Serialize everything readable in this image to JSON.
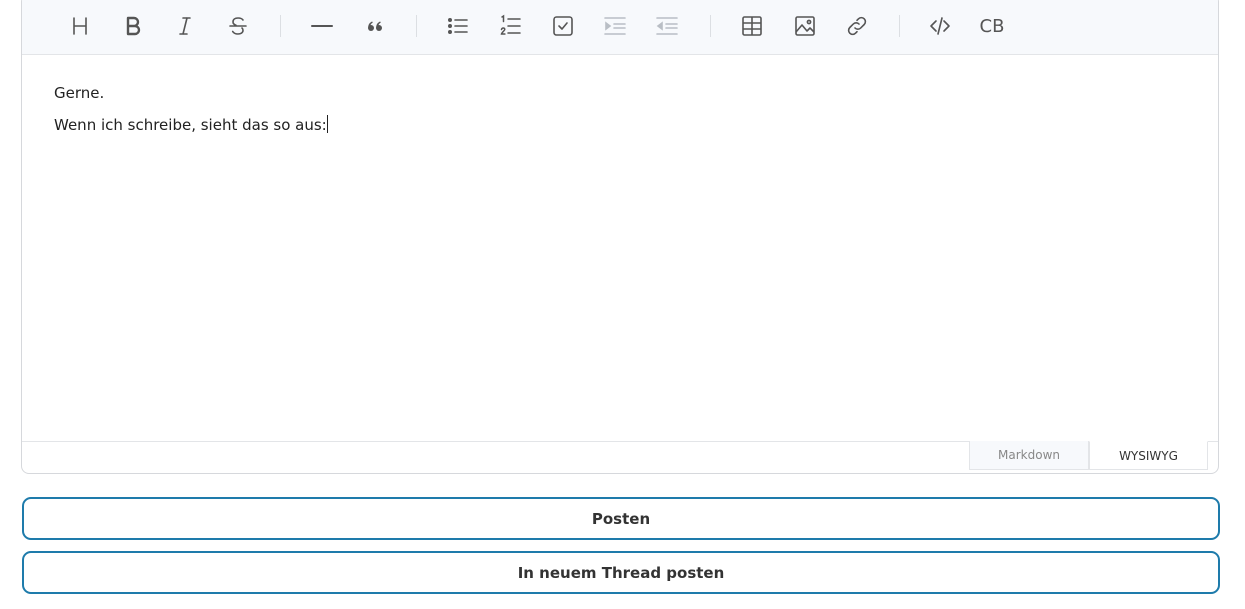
{
  "toolbar": {
    "buttons": [
      {
        "name": "heading",
        "icon": "heading-icon"
      },
      {
        "name": "bold",
        "icon": "bold-icon"
      },
      {
        "name": "italic",
        "icon": "italic-icon"
      },
      {
        "name": "strike",
        "icon": "strikethrough-icon"
      },
      {
        "name": "hr",
        "icon": "horizontal-rule-icon"
      },
      {
        "name": "quote",
        "icon": "quote-icon"
      },
      {
        "name": "bullet-list",
        "icon": "bullet-list-icon"
      },
      {
        "name": "ordered-list",
        "icon": "ordered-list-icon"
      },
      {
        "name": "task-list",
        "icon": "task-list-icon"
      },
      {
        "name": "indent",
        "icon": "indent-icon",
        "disabled": true
      },
      {
        "name": "outdent",
        "icon": "outdent-icon",
        "disabled": true
      },
      {
        "name": "table",
        "icon": "table-icon"
      },
      {
        "name": "image",
        "icon": "image-icon"
      },
      {
        "name": "link",
        "icon": "link-icon"
      },
      {
        "name": "code",
        "icon": "code-icon"
      },
      {
        "name": "codeblock",
        "icon": "codeblock-icon"
      }
    ],
    "codeblock_label": "CB"
  },
  "content": {
    "line1": "Gerne.",
    "line2": "Wenn ich schreibe, sieht das so aus:"
  },
  "mode_tabs": {
    "markdown": "Markdown",
    "wysiwyg": "WYSIWYG",
    "active": "wysiwyg"
  },
  "actions": {
    "post": "Posten",
    "post_new_thread": "In neuem Thread posten"
  },
  "colors": {
    "accent": "#1e7bab",
    "toolbar_bg": "#f7f9fc"
  }
}
